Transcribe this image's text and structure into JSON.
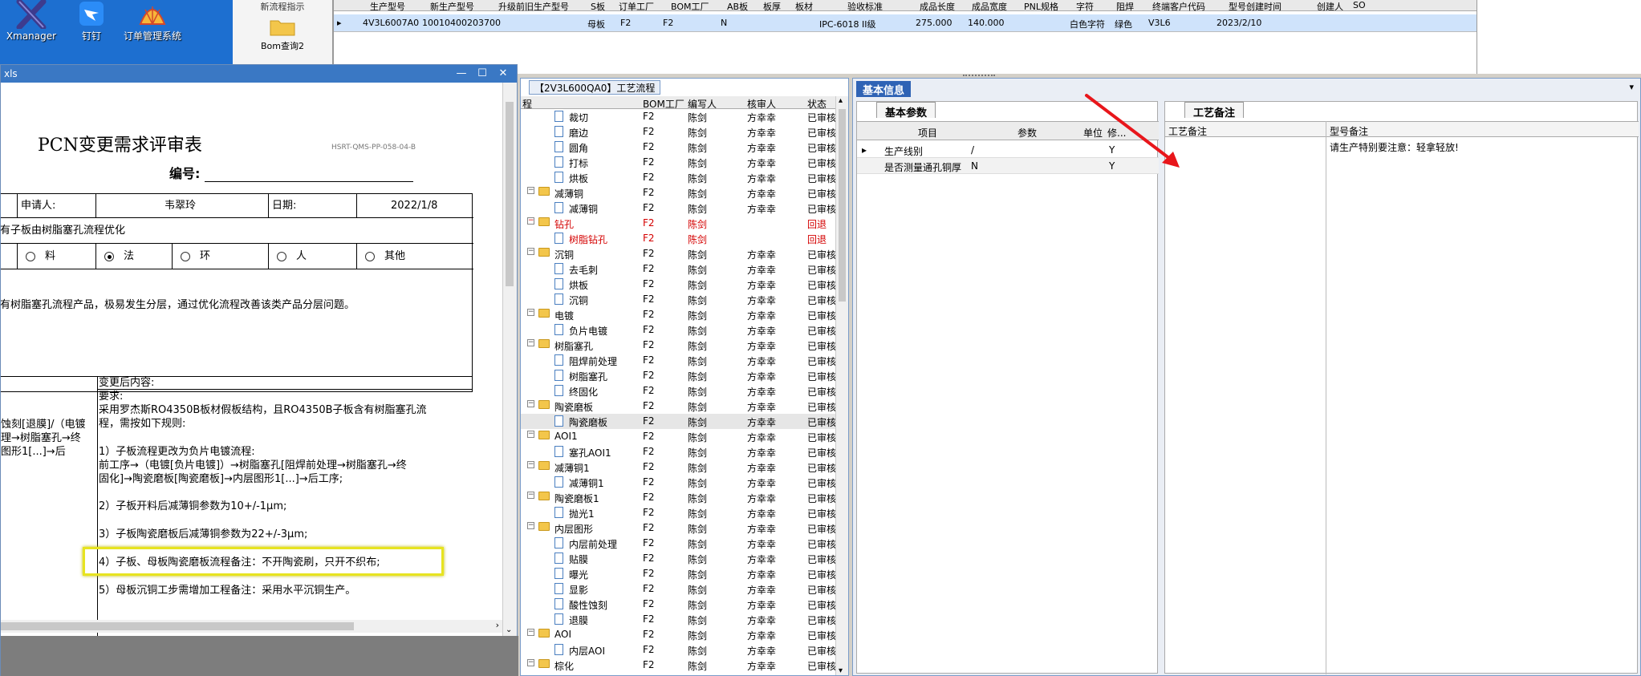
{
  "desktop": {
    "icons": [
      {
        "name": "Xmanager"
      },
      {
        "name": "钉钉"
      },
      {
        "name": "订单管理系统"
      }
    ],
    "bom_strip": {
      "top_label": "新流程指示",
      "bom_label": "Bom查询2"
    }
  },
  "top_grid": {
    "headers": [
      "生产型号",
      "新生产型号",
      "升级前旧生产型号",
      "S板",
      "订单工厂",
      "BOM工厂",
      "AB板",
      "板厚",
      "板材",
      "验收标准",
      "成品长度",
      "成品宽度",
      "PNL规格",
      "字符",
      "阻焊",
      "终端客户代码",
      "型号创建时间",
      "创建人",
      "SO"
    ],
    "row": [
      "4V3L6007A0",
      "10010400203700",
      "母板",
      "F2",
      "F2",
      "N",
      "IPC-6018 II级",
      "275.000",
      "140.000",
      "白色字符",
      "绿色",
      "V3L6",
      "2023/2/10"
    ]
  },
  "doc_window": {
    "title": "xls",
    "heading": "PCN变更需求评审表",
    "form_code": "HSRT-QMS-PP-058-04-B",
    "number_label": "编号:",
    "applicant_label": "申请人:",
    "applicant": "韦翠玲",
    "date_label": "日期:",
    "date": "2022/1/8",
    "subject": "有子板由树脂塞孔流程优化",
    "categories": [
      {
        "label": "料",
        "checked": false
      },
      {
        "label": "法",
        "checked": true
      },
      {
        "label": "环",
        "checked": false
      },
      {
        "label": "人",
        "checked": false
      },
      {
        "label": "其他",
        "checked": false
      }
    ],
    "reason": "有树脂塞孔流程产品，极易发生分层，通过优化流程改善该类产品分层问题。",
    "after_label": "变更后内容:",
    "before_lines": [
      "蚀刻[退膜]/（电镀",
      "理→树脂塞孔→终",
      "图形1[...]→后"
    ],
    "after_lines": [
      "要求:",
      "采用罗杰斯RO4350B板材假板结构，且RO4350B子板含有树脂塞孔流",
      "程，需按如下规则:",
      "",
      "1）子板流程更改为负片电镀流程:",
      "前工序→（电镀[负片电镀]）→树脂塞孔[阻焊前处理→树脂塞孔→终",
      "固化]→陶瓷磨板[陶瓷磨板]→内层图形1[...]→后工序;",
      "",
      "2）子板开料后减薄铜参数为10+/-1μm;",
      "",
      "3）子板陶瓷磨板后减薄铜参数为22+/-3μm;",
      "",
      "4）子板、母板陶瓷磨板流程备注：不开陶瓷刷，只开不织布;",
      "",
      "5）母板沉铜工步需增加工程备注：采用水平沉铜生产。"
    ]
  },
  "process_tree": {
    "tab": "【2V3L600QA0】工艺流程",
    "headers": [
      "程",
      "BOM工厂",
      "编写人",
      "核审人",
      "状态"
    ],
    "rows": [
      {
        "level": 2,
        "type": "file",
        "name": "裁切",
        "bom": "F2",
        "author": "陈剑",
        "reviewer": "方幸幸",
        "status": "已审核"
      },
      {
        "level": 2,
        "type": "file",
        "name": "磨边",
        "bom": "F2",
        "author": "陈剑",
        "reviewer": "方幸幸",
        "status": "已审核"
      },
      {
        "level": 2,
        "type": "file",
        "name": "圆角",
        "bom": "F2",
        "author": "陈剑",
        "reviewer": "方幸幸",
        "status": "已审核"
      },
      {
        "level": 2,
        "type": "file",
        "name": "打标",
        "bom": "F2",
        "author": "陈剑",
        "reviewer": "方幸幸",
        "status": "已审核"
      },
      {
        "level": 2,
        "type": "file",
        "name": "烘板",
        "bom": "F2",
        "author": "陈剑",
        "reviewer": "方幸幸",
        "status": "已审核"
      },
      {
        "level": 1,
        "type": "folder",
        "name": "减薄铜",
        "bom": "F2",
        "author": "陈剑",
        "reviewer": "方幸幸",
        "status": "已审核"
      },
      {
        "level": 2,
        "type": "file",
        "name": "减薄铜",
        "bom": "F2",
        "author": "陈剑",
        "reviewer": "方幸幸",
        "status": "已审核"
      },
      {
        "level": 1,
        "type": "folder",
        "name": "钻孔",
        "bom": "F2",
        "author": "陈剑",
        "reviewer": "",
        "status": "回退",
        "red": true
      },
      {
        "level": 2,
        "type": "file",
        "name": "树脂钻孔",
        "bom": "F2",
        "author": "陈剑",
        "reviewer": "",
        "status": "回退",
        "red": true
      },
      {
        "level": 1,
        "type": "folder",
        "name": "沉铜",
        "bom": "F2",
        "author": "陈剑",
        "reviewer": "方幸幸",
        "status": "已审核"
      },
      {
        "level": 2,
        "type": "file",
        "name": "去毛刺",
        "bom": "F2",
        "author": "陈剑",
        "reviewer": "方幸幸",
        "status": "已审核"
      },
      {
        "level": 2,
        "type": "file",
        "name": "烘板",
        "bom": "F2",
        "author": "陈剑",
        "reviewer": "方幸幸",
        "status": "已审核"
      },
      {
        "level": 2,
        "type": "file",
        "name": "沉铜",
        "bom": "F2",
        "author": "陈剑",
        "reviewer": "方幸幸",
        "status": "已审核"
      },
      {
        "level": 1,
        "type": "folder",
        "name": "电镀",
        "bom": "F2",
        "author": "陈剑",
        "reviewer": "方幸幸",
        "status": "已审核"
      },
      {
        "level": 2,
        "type": "file",
        "name": "负片电镀",
        "bom": "F2",
        "author": "陈剑",
        "reviewer": "方幸幸",
        "status": "已审核"
      },
      {
        "level": 1,
        "type": "folder",
        "name": "树脂塞孔",
        "bom": "F2",
        "author": "陈剑",
        "reviewer": "方幸幸",
        "status": "已审核"
      },
      {
        "level": 2,
        "type": "file",
        "name": "阻焊前处理",
        "bom": "F2",
        "author": "陈剑",
        "reviewer": "方幸幸",
        "status": "已审核"
      },
      {
        "level": 2,
        "type": "file",
        "name": "树脂塞孔",
        "bom": "F2",
        "author": "陈剑",
        "reviewer": "方幸幸",
        "status": "已审核"
      },
      {
        "level": 2,
        "type": "file",
        "name": "终固化",
        "bom": "F2",
        "author": "陈剑",
        "reviewer": "方幸幸",
        "status": "已审核"
      },
      {
        "level": 1,
        "type": "folder",
        "name": "陶瓷磨板",
        "bom": "F2",
        "author": "陈剑",
        "reviewer": "方幸幸",
        "status": "已审核"
      },
      {
        "level": 2,
        "type": "file",
        "name": "陶瓷磨板",
        "bom": "F2",
        "author": "陈剑",
        "reviewer": "方幸幸",
        "status": "已审核",
        "selected": true
      },
      {
        "level": 1,
        "type": "folder",
        "name": "AOI1",
        "bom": "F2",
        "author": "陈剑",
        "reviewer": "方幸幸",
        "status": "已审核"
      },
      {
        "level": 2,
        "type": "file",
        "name": "塞孔AOI1",
        "bom": "F2",
        "author": "陈剑",
        "reviewer": "方幸幸",
        "status": "已审核"
      },
      {
        "level": 1,
        "type": "folder",
        "name": "减薄铜1",
        "bom": "F2",
        "author": "陈剑",
        "reviewer": "方幸幸",
        "status": "已审核"
      },
      {
        "level": 2,
        "type": "file",
        "name": "减薄铜1",
        "bom": "F2",
        "author": "陈剑",
        "reviewer": "方幸幸",
        "status": "已审核"
      },
      {
        "level": 1,
        "type": "folder",
        "name": "陶瓷磨板1",
        "bom": "F2",
        "author": "陈剑",
        "reviewer": "方幸幸",
        "status": "已审核"
      },
      {
        "level": 2,
        "type": "file",
        "name": "抛光1",
        "bom": "F2",
        "author": "陈剑",
        "reviewer": "方幸幸",
        "status": "已审核"
      },
      {
        "level": 1,
        "type": "folder",
        "name": "内层图形",
        "bom": "F2",
        "author": "陈剑",
        "reviewer": "方幸幸",
        "status": "已审核"
      },
      {
        "level": 2,
        "type": "file",
        "name": "内层前处理",
        "bom": "F2",
        "author": "陈剑",
        "reviewer": "方幸幸",
        "status": "已审核"
      },
      {
        "level": 2,
        "type": "file",
        "name": "贴膜",
        "bom": "F2",
        "author": "陈剑",
        "reviewer": "方幸幸",
        "status": "已审核"
      },
      {
        "level": 2,
        "type": "file",
        "name": "曝光",
        "bom": "F2",
        "author": "陈剑",
        "reviewer": "方幸幸",
        "status": "已审核"
      },
      {
        "level": 2,
        "type": "file",
        "name": "显影",
        "bom": "F2",
        "author": "陈剑",
        "reviewer": "方幸幸",
        "status": "已审核"
      },
      {
        "level": 2,
        "type": "file",
        "name": "酸性蚀刻",
        "bom": "F2",
        "author": "陈剑",
        "reviewer": "方幸幸",
        "status": "已审核"
      },
      {
        "level": 2,
        "type": "file",
        "name": "退膜",
        "bom": "F2",
        "author": "陈剑",
        "reviewer": "方幸幸",
        "status": "已审核"
      },
      {
        "level": 1,
        "type": "folder",
        "name": "AOI",
        "bom": "F2",
        "author": "陈剑",
        "reviewer": "方幸幸",
        "status": "已审核"
      },
      {
        "level": 2,
        "type": "file",
        "name": "内层AOI",
        "bom": "F2",
        "author": "陈剑",
        "reviewer": "方幸幸",
        "status": "已审核"
      },
      {
        "level": 1,
        "type": "folder",
        "name": "棕化",
        "bom": "F2",
        "author": "陈剑",
        "reviewer": "方幸幸",
        "status": "已审核"
      }
    ]
  },
  "info_panel": {
    "tab": "基本信息",
    "basic_tab": "基本参数",
    "param_headers": [
      "项目",
      "参数",
      "单位",
      "修..."
    ],
    "params": [
      {
        "item": "生产线别",
        "value": "/",
        "unit": "",
        "mod": "Y"
      },
      {
        "item": "是否测量通孔铜厚",
        "value": "N",
        "unit": "",
        "mod": "Y"
      }
    ],
    "craft_tab": "工艺备注",
    "craft_headers": [
      "工艺备注",
      "型号备注"
    ],
    "model_note": "请生产特别要注意：轻拿轻放!"
  },
  "colors": {
    "annotation_arrow": "#e8161b",
    "highlight_box": "#e7e31f",
    "selected_row": "#cfe3fb",
    "title_bar": "#3a78c4"
  }
}
